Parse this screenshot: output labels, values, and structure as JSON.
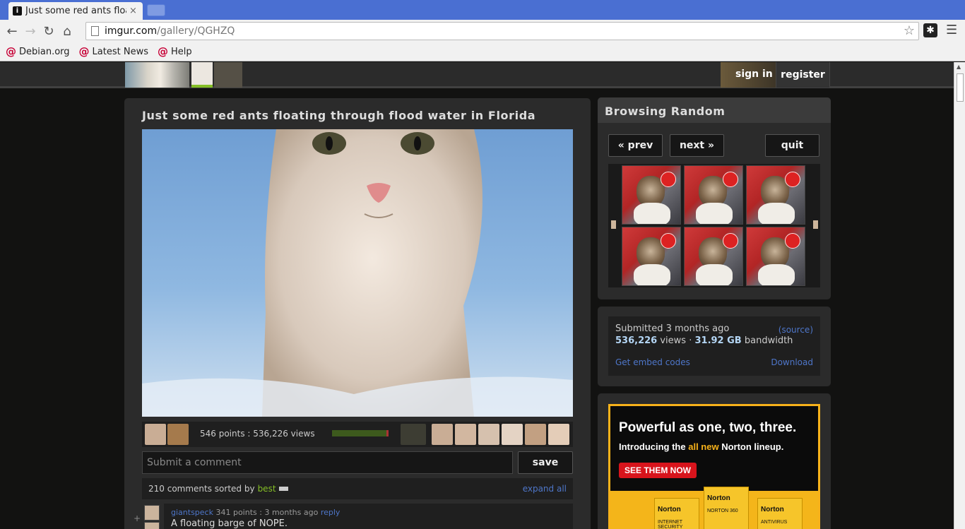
{
  "browser": {
    "tab_title": "Just some red ants floa",
    "tab_close": "×",
    "url_host": "imgur.com",
    "url_path": "/gallery/QGHZQ",
    "bookmarks": [
      {
        "label": "Debian.org"
      },
      {
        "label": "Latest News"
      },
      {
        "label": "Help"
      }
    ]
  },
  "topbar": {
    "signin": "sign in",
    "register": "register"
  },
  "post": {
    "title": "Just some red ants floating through flood water in Florida",
    "stats": "546 points : 536,226 views",
    "vote_ratio": 0.96,
    "comment_placeholder": "Submit a comment",
    "save_label": "save",
    "comments_count_text": "210 comments sorted by",
    "sort": "best",
    "expand_all": "expand all"
  },
  "comment": {
    "plus": "+",
    "author": "giantspeck",
    "meta": "341 points : 3 months ago",
    "reply": "reply",
    "text": "A floating barge of NOPE."
  },
  "browse": {
    "heading": "Browsing Random",
    "prev": "« prev",
    "next": "next »",
    "quit": "quit"
  },
  "info": {
    "submitted": "Submitted 3 months ago",
    "source": "(source)",
    "views_num": "536,226",
    "views_label": "views ·",
    "bandwidth_num": "31.92 GB",
    "bandwidth_label": "bandwidth",
    "embed": "Get embed codes",
    "download": "Download"
  },
  "ad": {
    "headline": "Powerful as one, two, three.",
    "sub_pre": "Introducing the",
    "sub_highlight": "all new",
    "sub_post": "Norton lineup.",
    "cta": "SEE THEM NOW",
    "boxes": [
      {
        "brand": "Norton",
        "product": "INTERNET SECURITY"
      },
      {
        "brand": "Norton",
        "product": "NORTON 360"
      },
      {
        "brand": "Norton",
        "product": "ANTIVIRUS"
      }
    ]
  },
  "colors": {
    "accent_green": "#85bf25",
    "link_blue": "#4e76c9",
    "panel": "#2b2b2b",
    "background": "#121211",
    "norton_yellow": "#f7b21a"
  }
}
